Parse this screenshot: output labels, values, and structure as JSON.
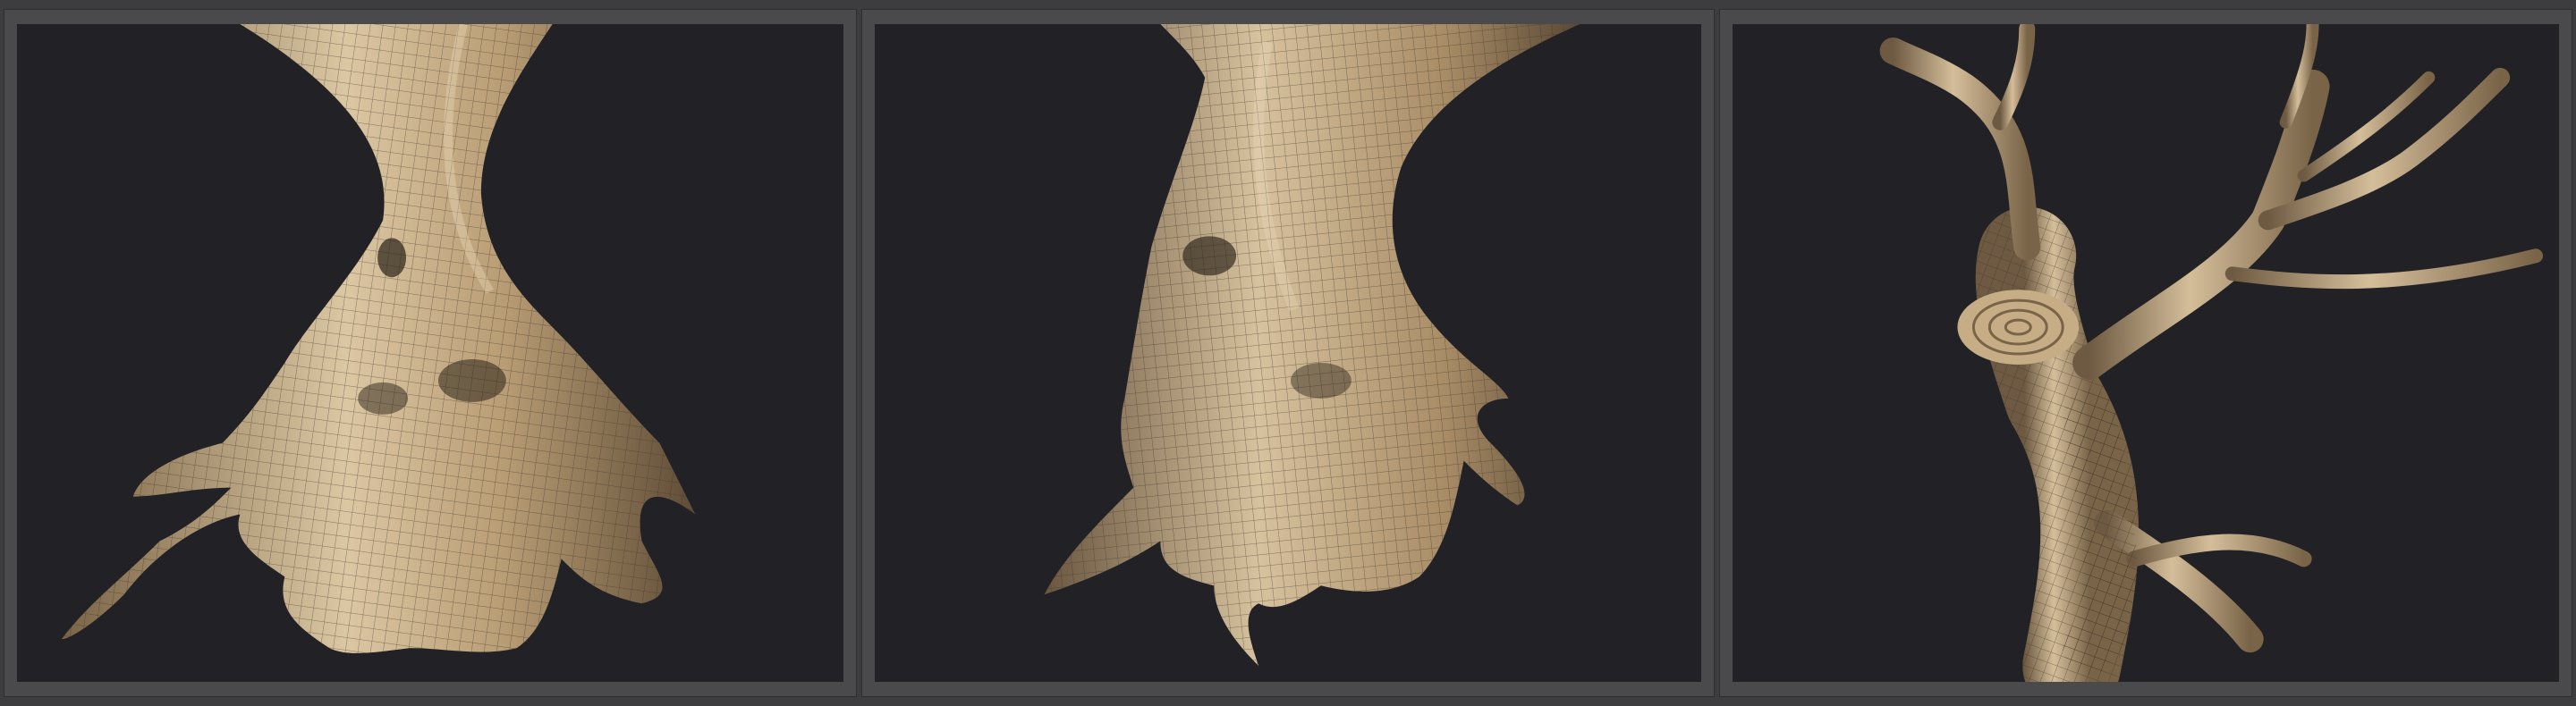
{
  "colors": {
    "frame": "#4a4a4c",
    "viewport": "#222226",
    "bark_light": "#d9c3a0",
    "bark_mid": "#b89c74",
    "bark_dark": "#6e5a40",
    "wire": "#3a3a3a"
  },
  "panels": [
    {
      "view": "front"
    },
    {
      "view": "three-quarter"
    },
    {
      "view": "top"
    }
  ]
}
